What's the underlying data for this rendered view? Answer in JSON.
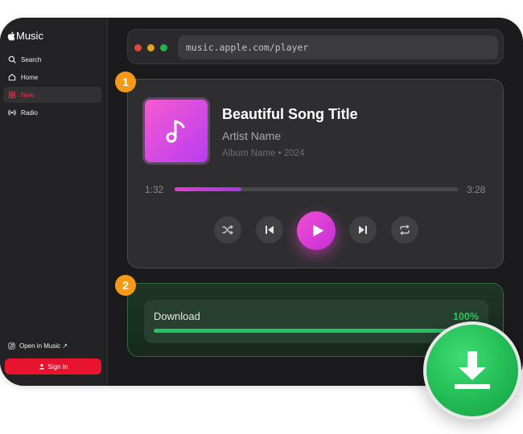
{
  "sidebar": {
    "logo_text": "Music",
    "items": [
      {
        "label": "Search",
        "icon": "search-icon",
        "active": false
      },
      {
        "label": "Home",
        "icon": "home-icon",
        "active": false
      },
      {
        "label": "New",
        "icon": "grid-icon",
        "active": true
      },
      {
        "label": "Radio",
        "icon": "radio-icon",
        "active": false
      }
    ],
    "open_in_music": "Open in Music ↗",
    "sign_in": "Sign In"
  },
  "browser": {
    "url": "music.apple.com/player",
    "dot_colors": [
      "#e0443a",
      "#e3a41d",
      "#22b34a"
    ]
  },
  "player": {
    "badge": "1",
    "song_title": "Beautiful Song Title",
    "artist": "Artist Name",
    "album_line": "Album Name • 2024",
    "elapsed": "1:32",
    "duration": "3:28",
    "progress": 0.235,
    "controls": [
      "shuffle-icon",
      "previous-icon",
      "play-icon",
      "next-icon",
      "repeat-icon"
    ]
  },
  "download": {
    "badge": "2",
    "label": "Download",
    "percent_text": "100%",
    "progress": 1.0
  },
  "colors": {
    "accent_pink": "#f04ed2",
    "badge_orange": "#f59a18",
    "download_green": "#22c55e",
    "sign_in_red": "#e8132f"
  }
}
